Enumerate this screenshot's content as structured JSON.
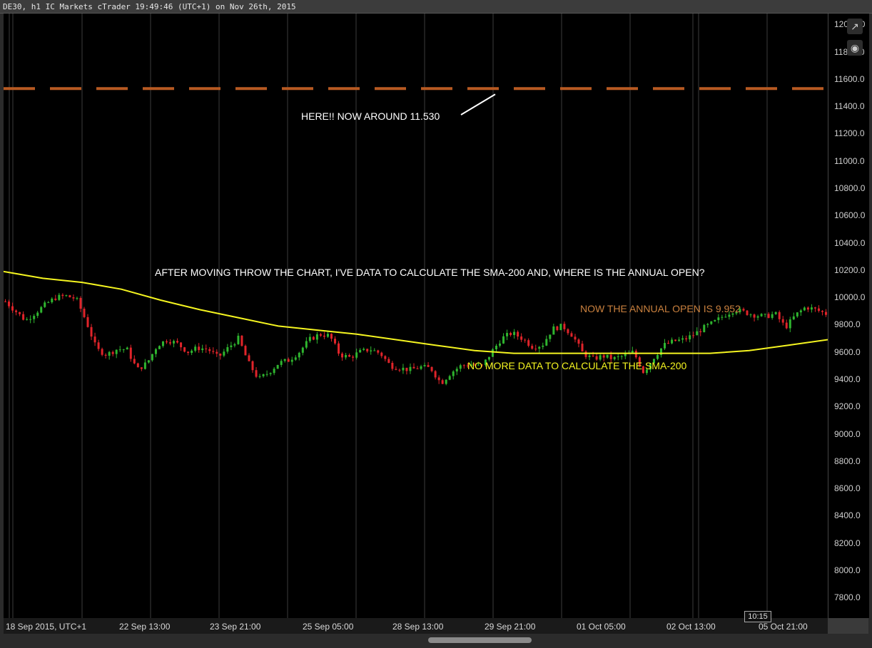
{
  "window": {
    "title": "DE30, h1 IC Markets cTrader 19:49:46 (UTC+1) on Nov 26th, 2015"
  },
  "toolbar": {
    "popout_icon": "external-link-icon",
    "screenshot_icon": "camera-icon"
  },
  "time_badge": "10:15",
  "annotations": {
    "here_label": "HERE!! NOW AROUND 11.530",
    "moving_label": "AFTER MOVING THROW THE CHART, I'VE DATA TO CALCULATE THE SMA-200 AND, WHERE IS THE ANNUAL OPEN?",
    "annual_open_label": "NOW THE ANNUAL OPEN IS 9.952",
    "no_data_label": "NO MORE DATA TO CALCULATE THE SMA-200"
  },
  "colors": {
    "background": "#000000",
    "sma_line": "#f5f520",
    "annual_open_line": "#b85a22",
    "bull_candle": "#2fb52f",
    "bear_candle": "#e0242a",
    "annual_open_text": "#c9803e",
    "no_data_text": "#f5f520",
    "white_text": "#ffffff"
  },
  "chart_data": {
    "type": "candlestick",
    "symbol": "DE30",
    "timeframe": "h1",
    "y_axis": {
      "range": [
        7650,
        12080
      ],
      "ticks": [
        "12000.0",
        "11800.0",
        "11600.0",
        "11400.0",
        "11200.0",
        "11000.0",
        "10800.0",
        "10600.0",
        "10400.0",
        "10200.0",
        "10000.0",
        "9800.0",
        "9600.0",
        "9400.0",
        "9200.0",
        "9000.0",
        "8800.0",
        "8600.0",
        "8400.0",
        "8200.0",
        "8000.0",
        "7800.0"
      ]
    },
    "x_axis": {
      "ticks": [
        "18 Sep 2015, UTC+1",
        "22 Sep 13:00",
        "23 Sep 21:00",
        "25 Sep 05:00",
        "28 Sep 13:00",
        "29 Sep 21:00",
        "01 Oct 05:00",
        "02 Oct 13:00",
        "05 Oct 21:00"
      ]
    },
    "annual_open_level": 11530,
    "close_series": [
      9970,
      9900,
      9830,
      9890,
      9950,
      10000,
      10010,
      9990,
      9820,
      9620,
      9580,
      9620,
      9620,
      9470,
      9520,
      9650,
      9690,
      9660,
      9600,
      9630,
      9620,
      9560,
      9630,
      9700,
      9520,
      9400,
      9450,
      9520,
      9540,
      9600,
      9690,
      9730,
      9720,
      9580,
      9560,
      9600,
      9620,
      9590,
      9500,
      9480,
      9470,
      9490,
      9480,
      9370,
      9450,
      9500,
      9510,
      9490,
      9600,
      9700,
      9740,
      9700,
      9640,
      9650,
      9770,
      9790,
      9720,
      9590,
      9550,
      9570,
      9550,
      9570,
      9600,
      9450,
      9560,
      9650,
      9680,
      9690,
      9730,
      9780,
      9820,
      9870,
      9910,
      9890,
      9870,
      9860,
      9880,
      9780,
      9870,
      9930,
      9910,
      9880
    ],
    "sma_200": [
      10190,
      10140,
      10110,
      10060,
      9980,
      9910,
      9850,
      9790,
      9760,
      9730,
      9690,
      9650,
      9610,
      9590,
      9590,
      9590,
      9590,
      9590,
      9590,
      9610,
      9650,
      9690
    ],
    "sma_start_index": 0
  }
}
